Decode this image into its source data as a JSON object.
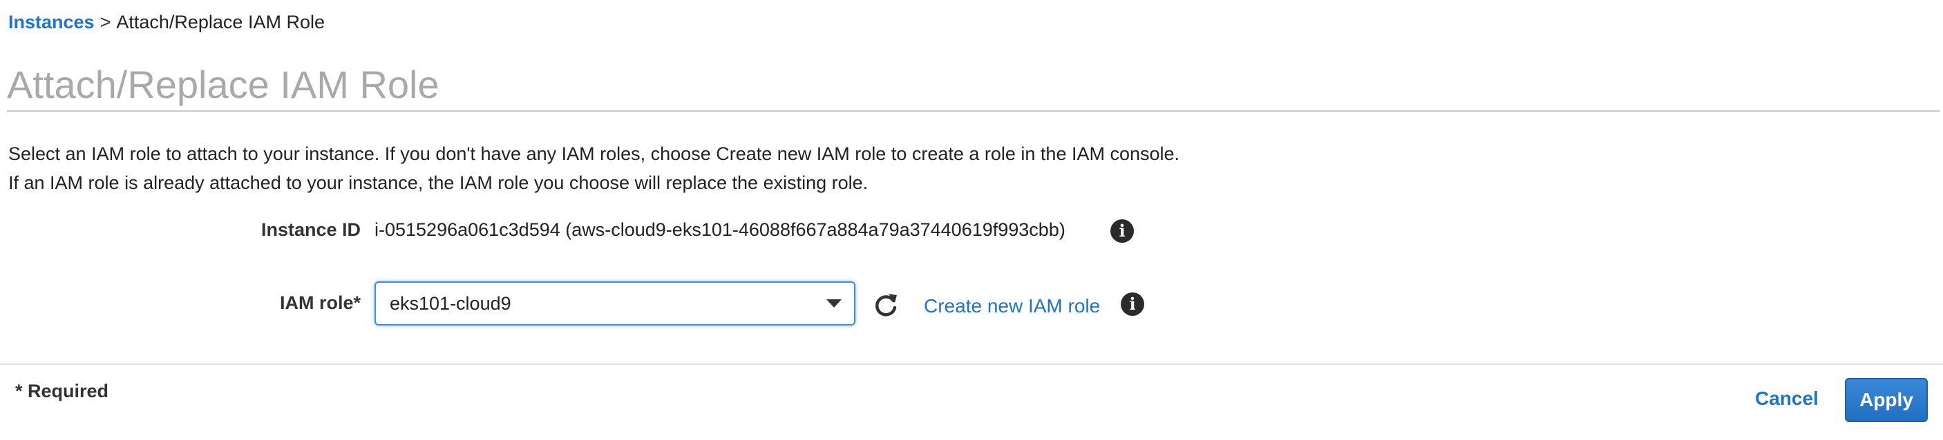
{
  "breadcrumb": {
    "link_label": "Instances",
    "separator": ">",
    "current": "Attach/Replace IAM Role"
  },
  "page": {
    "title": "Attach/Replace IAM Role"
  },
  "description": {
    "line1": "Select an IAM role to attach to your instance. If you don't have any IAM roles, choose Create new IAM role to create a role in the IAM console.",
    "line2": "If an IAM role is already attached to your instance, the IAM role you choose will replace the existing role."
  },
  "form": {
    "instance_id": {
      "label": "Instance ID",
      "value": "i-0515296a061c3d594 (aws-cloud9-eks101-46088f667a884a79a37440619f993cbb)"
    },
    "iam_role": {
      "label": "IAM role*",
      "selected": "eks101-cloud9"
    },
    "create_role_link": "Create new IAM role",
    "info_glyph": "i"
  },
  "footer": {
    "required_note": "* Required",
    "cancel_label": "Cancel",
    "apply_label": "Apply"
  },
  "icons": {
    "info": "info-circle-icon",
    "refresh": "refresh-icon",
    "caret": "chevron-down-icon"
  },
  "colors": {
    "link": "#1f74c9",
    "title": "#a9a9a9",
    "focus_border": "#3d8de0",
    "primary_button": "#1f6fc2"
  }
}
